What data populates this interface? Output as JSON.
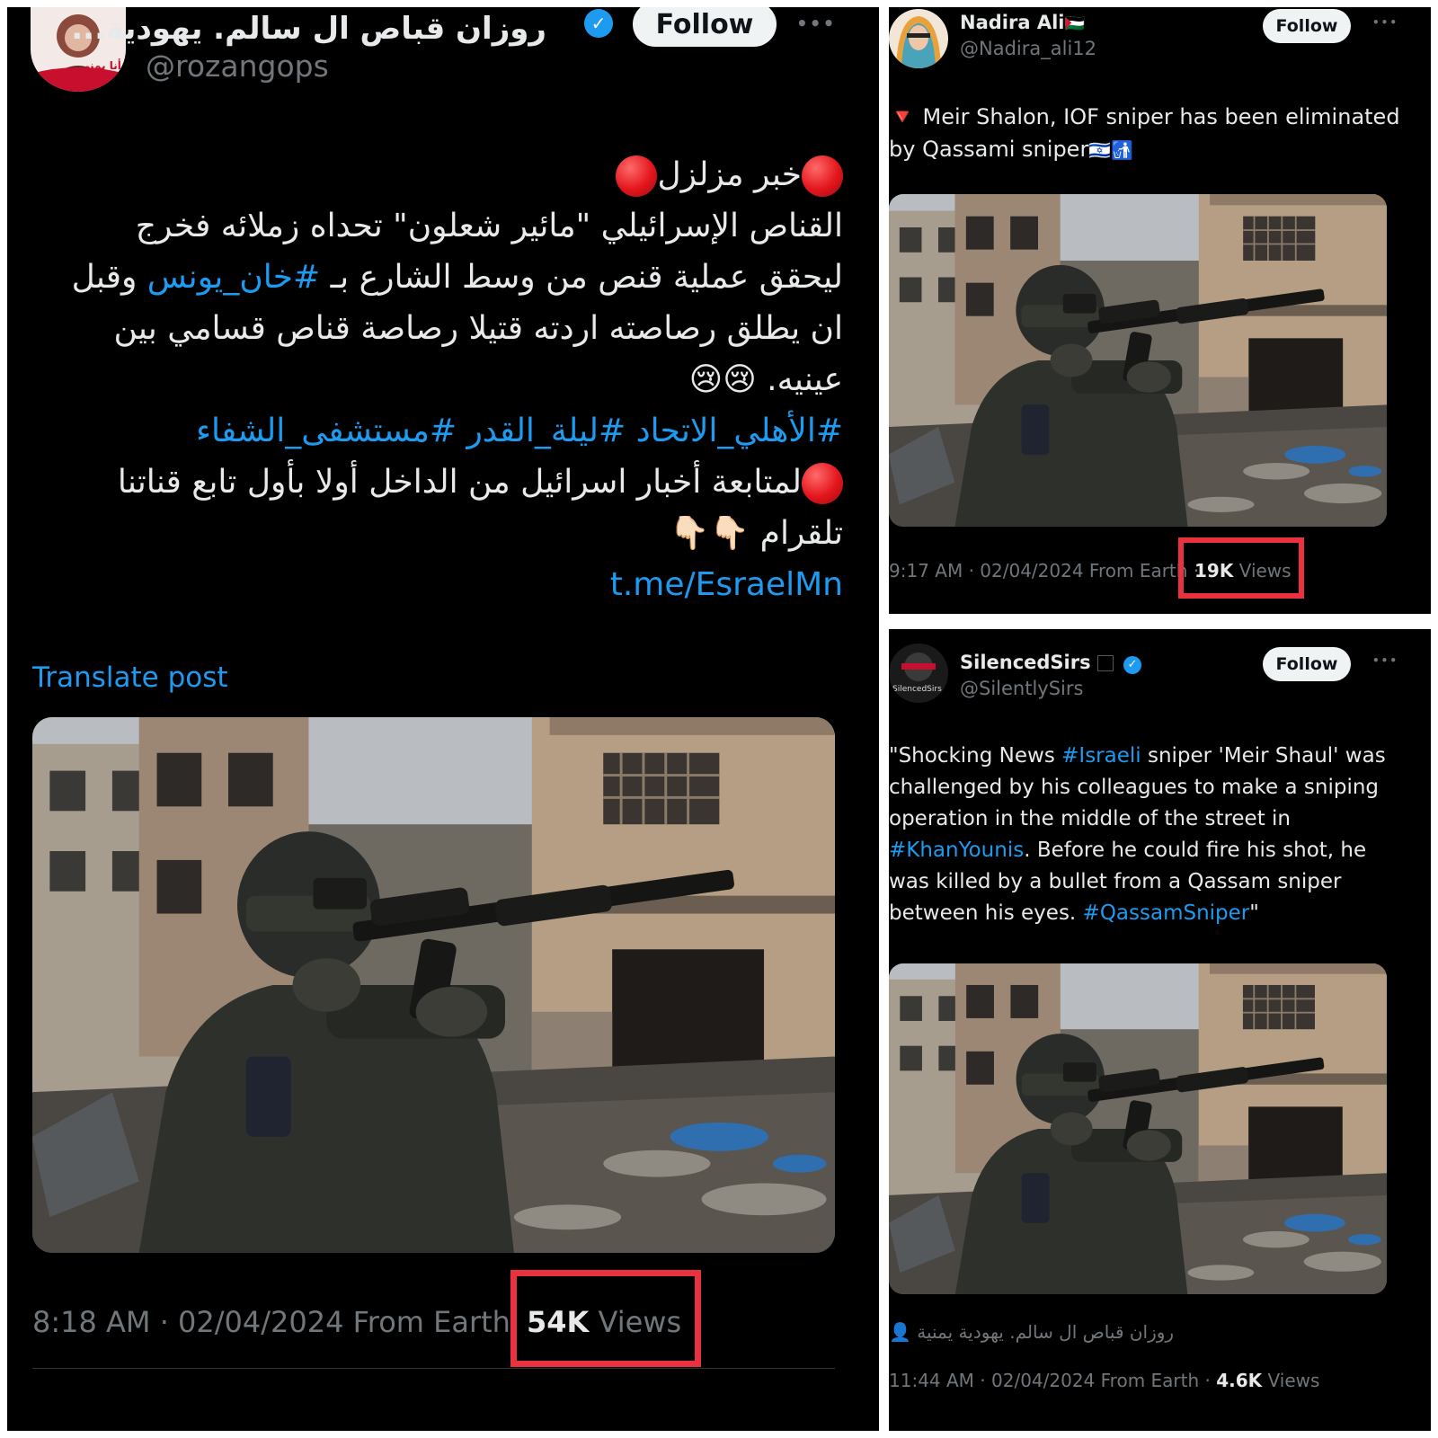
{
  "post1": {
    "display_name": "روزان قباص ال سالم. يهودية...",
    "handle": "@rozangops",
    "follow_label": "Follow",
    "more_label": "•••",
    "avatar_caption": "أنا يمني",
    "body_lines": [
      "خبر مزلزل",
      "القناص الإسرائيلي \"مائير شعلون\" تحداه زملائه فخرج",
      "ليحقق عملية قنص من وسط الشارع بـ ",
      "#خان_يونس",
      " وقبل",
      "ان يطلق رصاصته اردته قتيلا رصاصة قناص قسامي بين",
      "عينيه. 😢😢",
      "#الأهلي_الاتحاد #ليلة_القدر #مستشفى_الشفاء",
      "لمتابعة أخبار اسرائيل من الداخل أولا بأول تابع قناتنا",
      "تلقرام 👇🏻👇🏻",
      "t.me/EsraelMn"
    ],
    "translate_label": "Translate post",
    "time_date": "8:18 AM · 02/04/2024 From Earth",
    "views_count": "54K",
    "views_label": "Views"
  },
  "post2": {
    "display_name": "Nadira Ali",
    "flag": "🇵🇸",
    "handle": "@Nadira_ali12",
    "follow_label": "Follow",
    "more_label": "•••",
    "text_marker": "🔻",
    "text_line1": "Meir Shalon, IOF sniper has been eliminated",
    "text_line2": "by Qassami sniper",
    "text_emoji": "🇮🇱🚮",
    "time_date": "9:17 AM · 02/04/2024 From Earth ·",
    "views_count": "19K",
    "views_label": "Views"
  },
  "post3": {
    "display_name": "SilencedSirs",
    "handle": "@SilentlySirs",
    "follow_label": "Follow",
    "more_label": "•••",
    "avatar_caption": "SilencedSirs",
    "text_parts": {
      "l1a": "\"Shocking News ",
      "l1_tag": "#Israeli",
      "l1b": " sniper 'Meir Shaul' was",
      "l2": "challenged by his colleagues to make a sniping",
      "l3": "operation in the middle of the street in",
      "l4_tag": "#KhanYounis",
      "l4b": ". Before he could fire his shot, he",
      "l5": "was killed by a bullet from a Qassam sniper",
      "l6a": "between his eyes. ",
      "l6_tag": "#QassamSniper",
      "l6b": "\""
    },
    "repost_by": "روزان قباص ال سالم. يهودية يمنية",
    "time_date": "11:44 AM · 02/04/2024 From Earth ·",
    "views_count": "4.6K",
    "views_label": "Views"
  },
  "colors": {
    "background": "#000000",
    "link": "#1d9bf0",
    "muted": "#71767b",
    "highlight_box": "#e8323f",
    "follow_bg": "#eff3f4"
  }
}
